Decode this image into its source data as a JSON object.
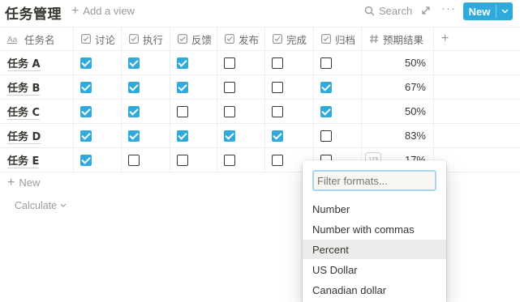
{
  "header": {
    "title": "任务管理",
    "add_view_label": "Add a view",
    "search_label": "Search",
    "more_label": "···",
    "new_button_label": "New"
  },
  "table": {
    "columns": [
      {
        "label": "任务名",
        "icon": "text-property-icon"
      },
      {
        "label": "讨论",
        "icon": "checkbox-property-icon"
      },
      {
        "label": "执行",
        "icon": "checkbox-property-icon"
      },
      {
        "label": "反馈",
        "icon": "checkbox-property-icon"
      },
      {
        "label": "发布",
        "icon": "checkbox-property-icon"
      },
      {
        "label": "完成",
        "icon": "checkbox-property-icon"
      },
      {
        "label": "归档",
        "icon": "checkbox-property-icon"
      },
      {
        "label": "预期结果",
        "icon": "number-property-icon"
      }
    ],
    "rows": [
      {
        "name": "任务 A",
        "checks": [
          true,
          true,
          true,
          false,
          false,
          false
        ],
        "result": "50%"
      },
      {
        "name": "任务 B",
        "checks": [
          true,
          true,
          true,
          false,
          false,
          true
        ],
        "result": "67%"
      },
      {
        "name": "任务 C",
        "checks": [
          true,
          true,
          false,
          false,
          false,
          true
        ],
        "result": "50%"
      },
      {
        "name": "任务 D",
        "checks": [
          true,
          true,
          true,
          true,
          true,
          false
        ],
        "result": "83%"
      },
      {
        "name": "任务 E",
        "checks": [
          true,
          false,
          false,
          false,
          false,
          false
        ],
        "result": "17%"
      }
    ],
    "format_icon_label": "123",
    "new_row_label": "New",
    "calculate_label": "Calculate"
  },
  "format_menu": {
    "filter_placeholder": "Filter formats...",
    "options": [
      "Number",
      "Number with commas",
      "Percent",
      "US Dollar",
      "Canadian dollar"
    ],
    "selected": "Percent"
  },
  "colors": {
    "accent": "#2eaadc",
    "text": "#37352f",
    "muted": "#9b9a97",
    "border": "#ededec"
  }
}
